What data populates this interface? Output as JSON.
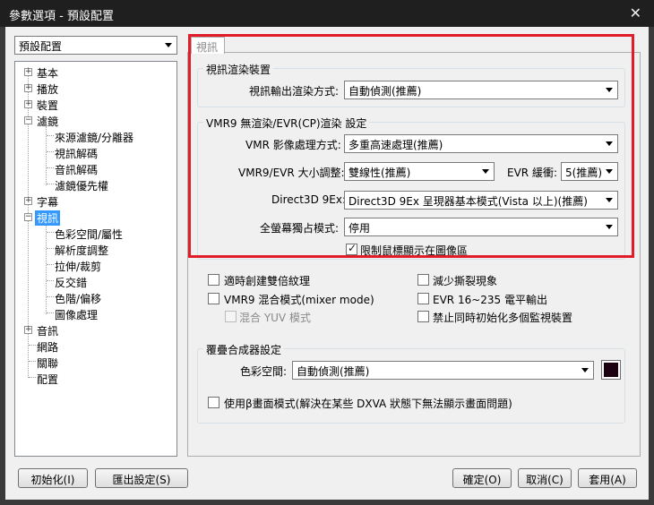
{
  "window": {
    "title": "參數選項 - 預設配置",
    "close_glyph": "✕"
  },
  "profile_select": {
    "value": "預設配置"
  },
  "tree": {
    "items": [
      {
        "label": "基本",
        "expander": "+"
      },
      {
        "label": "播放",
        "expander": "+"
      },
      {
        "label": "裝置",
        "expander": "+"
      },
      {
        "label": "濾鏡",
        "expander": "−"
      },
      {
        "label": "來源濾鏡/分離器"
      },
      {
        "label": "視訊解碼"
      },
      {
        "label": "音訊解碼"
      },
      {
        "label": "濾鏡優先權"
      },
      {
        "label": "字幕",
        "expander": "+"
      },
      {
        "label": "視訊",
        "expander": "−"
      },
      {
        "label": "色彩空間/屬性"
      },
      {
        "label": "解析度調整"
      },
      {
        "label": "拉伸/裁剪"
      },
      {
        "label": "反交錯"
      },
      {
        "label": "色階/偏移"
      },
      {
        "label": "圖像處理"
      },
      {
        "label": "音訊",
        "expander": "+"
      },
      {
        "label": "網路"
      },
      {
        "label": "關聯"
      },
      {
        "label": "配置"
      }
    ]
  },
  "tab": {
    "label": "視訊"
  },
  "render_group": {
    "title": "視訊渲染裝置",
    "output_label": "視訊輸出渲染方式:",
    "output_value": "自動偵測(推薦)"
  },
  "vmr_group": {
    "title": "VMR9 無渲染/EVR(CP)渲染 設定",
    "image_label": "VMR 影像處理方式:",
    "image_value": "多重高速處理(推薦)",
    "resize_label": "VMR9/EVR 大小調整:",
    "resize_value": "雙線性(推薦)",
    "evr_buffer_label": "EVR 緩衝:",
    "evr_buffer_value": "5(推薦)",
    "d3d_label": "Direct3D 9Ex:",
    "d3d_value": "Direct3D 9Ex 呈現器基本模式(Vista 以上)(推薦)",
    "fullscreen_label": "全螢幕獨占模式:",
    "fullscreen_value": "停用",
    "limit_cursor_label": "限制鼠標顯示在圖像區"
  },
  "options": {
    "double_texture": "適時創建雙倍紋理",
    "reduce_tearing": "減少撕裂現象",
    "vmr9_mixer": "VMR9 混合模式(mixer mode)",
    "evr_output": "EVR 16~235 電平輸出",
    "mix_yuv": "混合 YUV 模式",
    "disable_multi_monitor": "禁止同時初始化多個監視裝置"
  },
  "overlay_group": {
    "title": "覆疊合成器設定",
    "colorspace_label": "色彩空間:",
    "colorspace_value": "自動偵測(推薦)",
    "swatch_color": "#1a0010",
    "beta_mode_label": "使用β畫面模式(解決在某些 DXVA 狀態下無法顯示畫面問題)"
  },
  "buttons": {
    "init": "初始化(I)",
    "export": "匯出設定(S)",
    "ok": "確定(O)",
    "cancel": "取消(C)",
    "apply": "套用(A)"
  }
}
